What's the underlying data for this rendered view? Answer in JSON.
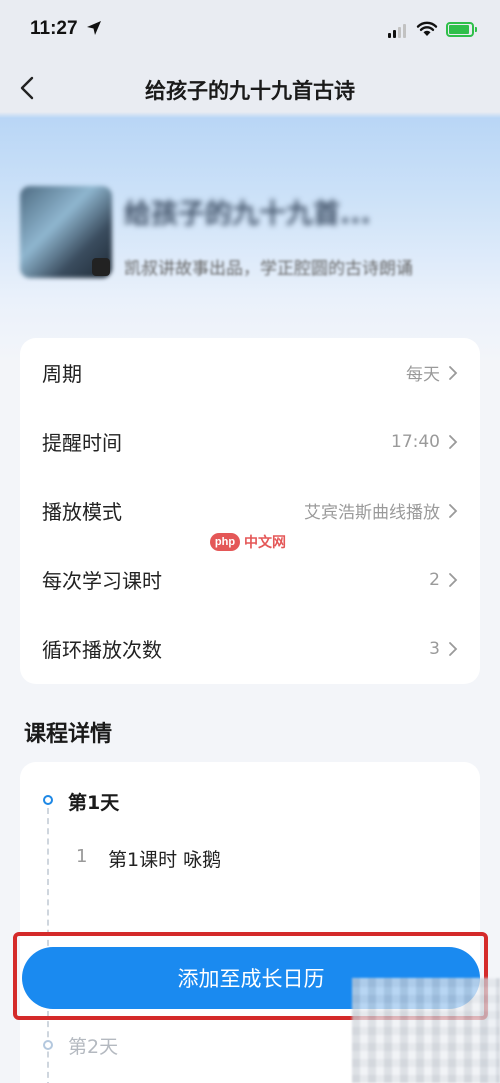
{
  "status_bar": {
    "time": "11:27"
  },
  "nav": {
    "title": "给孩子的九十九首古诗"
  },
  "course": {
    "title": "给孩子的九十九首...",
    "description": "凯叔讲故事出品，学正腔圆的古诗朗诵"
  },
  "settings": [
    {
      "label": "周期",
      "value": "每天"
    },
    {
      "label": "提醒时间",
      "value": "17:40"
    },
    {
      "label": "播放模式",
      "value": "艾宾浩斯曲线播放"
    },
    {
      "label": "每次学习课时",
      "value": "2"
    },
    {
      "label": "循环播放次数",
      "value": "3"
    }
  ],
  "details": {
    "section_title": "课程详情",
    "days": [
      {
        "label": "第1天",
        "lessons": [
          {
            "num": "1",
            "text": "第1课时 咏鹅"
          }
        ]
      },
      {
        "label": "第2天",
        "lessons": []
      }
    ]
  },
  "cta": {
    "label": "添加至成长日历"
  },
  "watermark": {
    "logo": "php",
    "text": "中文网"
  },
  "colors": {
    "accent": "#1a8af0",
    "highlight": "#d42a2a"
  }
}
